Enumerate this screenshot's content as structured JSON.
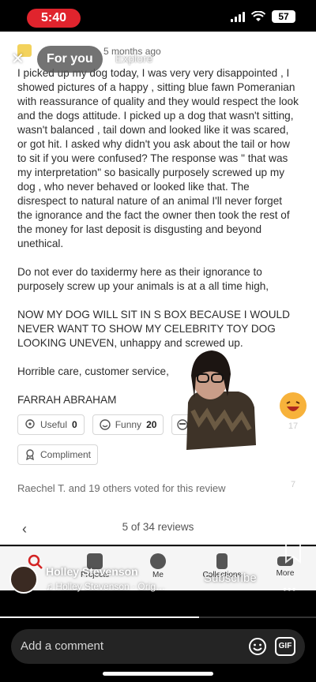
{
  "status_bar": {
    "time": "5:40",
    "battery": "57"
  },
  "review": {
    "time_ago": "5 months ago",
    "paragraphs": [
      "I picked up my dog today, I was very very disappointed , I showed pictures of a happy , sitting blue fawn Pomeranian with reassurance of quality and they would respect the look and the dogs attitude. I picked up a dog that wasn't sitting, wasn't balanced , tail down and looked like it was scared, or got hit. I asked why didn't you ask about the tail or how to sit if you were confused? The response was \" that was my interpretation\" so basically purposely screwed up my dog , who never behaved or looked like that. The disrespect to natural nature of an animal I'll never forget the ignorance and the fact the owner then took the rest of the money for last deposit is disgusting and beyond unethical.",
      "Do not ever do taxidermy here as their ignorance to purposely screw up your animals is at a all time high,",
      "NOW MY DOG WILL SIT IN S BOX BECAUSE I WOULD NEVER WANT TO SHOW MY CELEBRITY TOY DOG LOOKING UNEVEN, unhappy and screwed up.",
      "Horrible care, customer service,",
      "FARRAH ABRAHAM"
    ],
    "reactions": [
      {
        "label": "Useful",
        "count": "0"
      },
      {
        "label": "Funny",
        "count": "20"
      }
    ],
    "compliment_label": "Compliment",
    "voters_text": "Raechel T. and 19 others voted for this review",
    "pager_text": "5 of 34 reviews",
    "pager_prev": "‹"
  },
  "app_nav": {
    "items": [
      "Projects",
      "Me",
      "Collections",
      "More"
    ]
  },
  "tiktok": {
    "close": "✕",
    "for_you": "For you",
    "explore": "Explore",
    "creator_name": "Holley Stevenson",
    "sound": "♫ Holley Stevenson · Orig…",
    "subscribe": "Subscribe",
    "side_counts": [
      "17",
      "7"
    ],
    "progress": 0.63,
    "comment_placeholder": "Add a comment",
    "gif_label": "GIF"
  }
}
